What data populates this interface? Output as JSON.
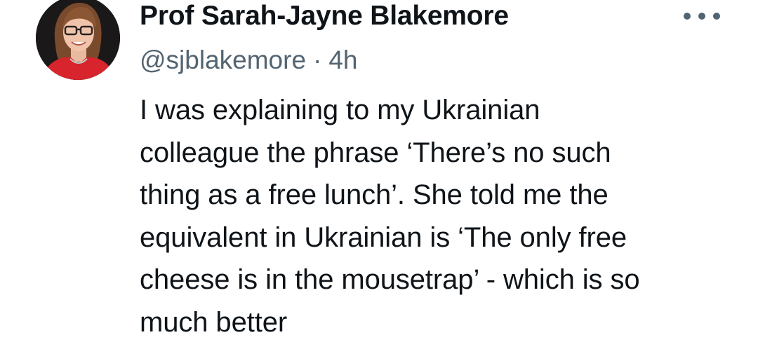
{
  "author": {
    "display_name": "Prof Sarah-Jayne Blakemore",
    "handle": "@sjblakemore",
    "separator": "·",
    "time": "4h",
    "avatar_icon": "profile-photo"
  },
  "actions": {
    "more_icon": "ellipsis-horizontal-icon"
  },
  "tweet": {
    "lines": [
      "I was explaining to my Ukrainian",
      "colleague the phrase ‘There’s no such",
      "thing as a free lunch’. She told me the",
      "equivalent in Ukrainian is ‘The only free",
      "cheese is in the mousetrap’ - which is so",
      "much better"
    ]
  },
  "colors": {
    "text_primary": "#0f1419",
    "text_secondary": "#536471",
    "background": "#ffffff"
  }
}
